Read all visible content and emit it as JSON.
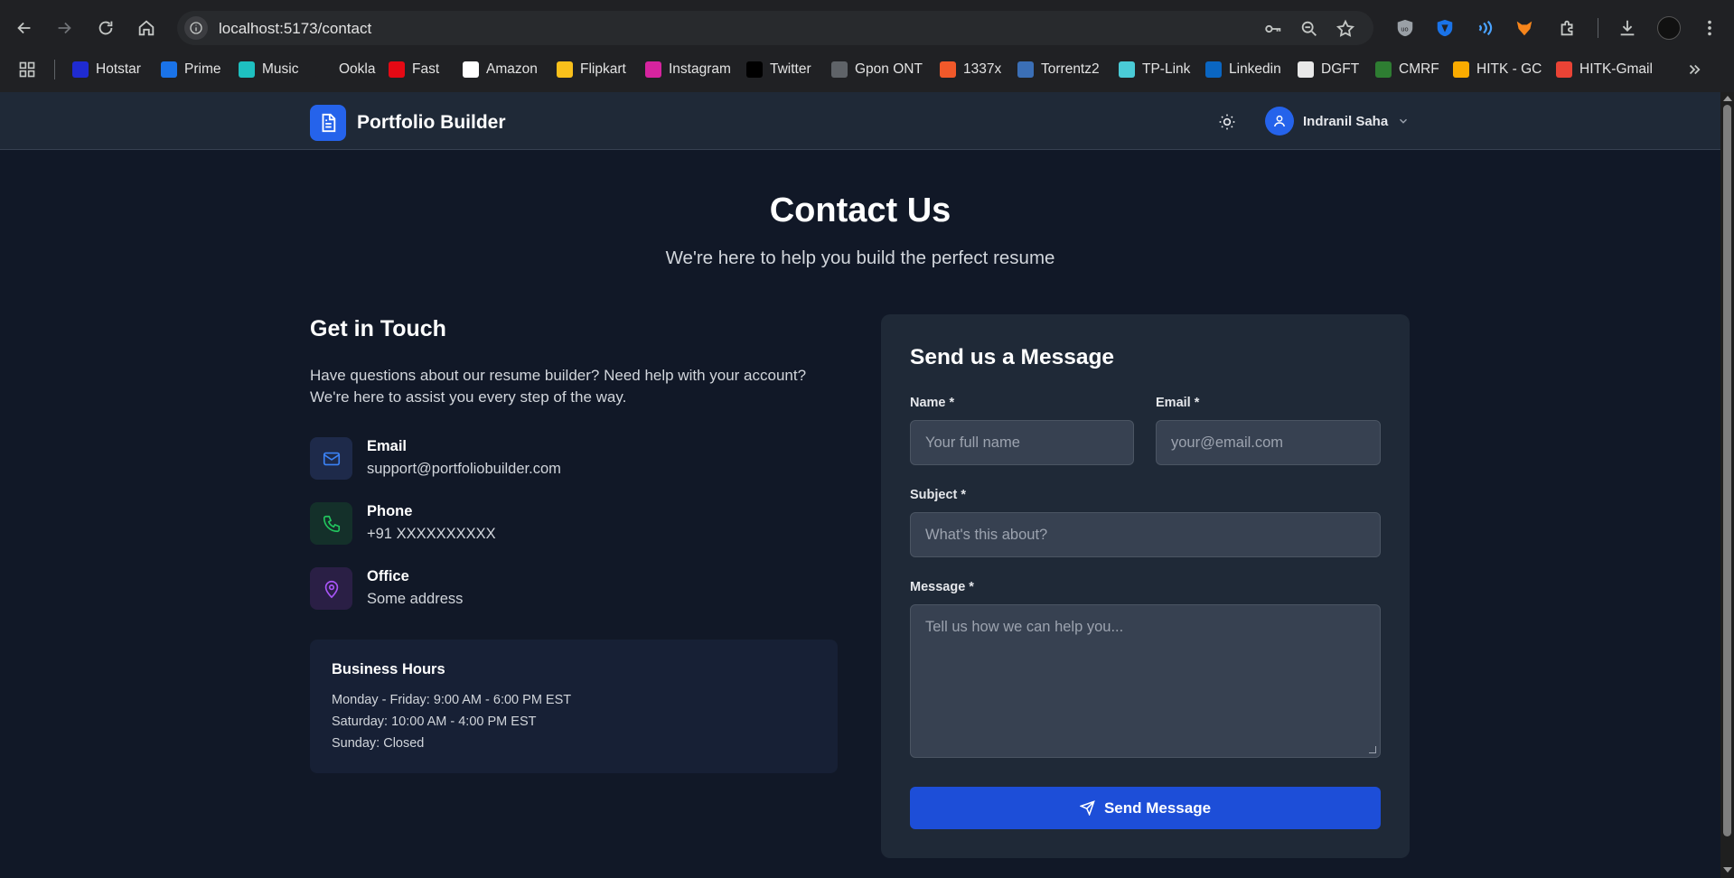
{
  "browser": {
    "url": "localhost:5173/contact",
    "bookmarks": [
      {
        "label": "Hotstar",
        "icon": "hotstar-icon",
        "color": "#1f2bd1"
      },
      {
        "label": "Prime",
        "icon": "prime-icon",
        "color": "#1a73e8"
      },
      {
        "label": "Music",
        "icon": "music-icon",
        "color": "#1ec0c0"
      },
      {
        "label": "Ookla",
        "icon": "ookla-icon",
        "color": "#202124"
      },
      {
        "label": "Fast",
        "icon": "fast-icon",
        "color": "#e50914"
      },
      {
        "label": "Amazon",
        "icon": "amazon-icon",
        "color": "#ffffff"
      },
      {
        "label": "Flipkart",
        "icon": "flipkart-icon",
        "color": "#f9c01b"
      },
      {
        "label": "Instagram",
        "icon": "instagram-icon",
        "color": "#d6249f"
      },
      {
        "label": "Twitter",
        "icon": "x-twitter-icon",
        "color": "#000000"
      },
      {
        "label": "Gpon ONT",
        "icon": "globe-icon",
        "color": "#5f6368"
      },
      {
        "label": "1337x",
        "icon": "1337x-icon",
        "color": "#f1592a"
      },
      {
        "label": "Torrentz2",
        "icon": "torrentz-icon",
        "color": "#3b6fb6"
      },
      {
        "label": "TP-Link",
        "icon": "tplink-icon",
        "color": "#4acbd6"
      },
      {
        "label": "Linkedin",
        "icon": "linkedin-icon",
        "color": "#0a66c2"
      },
      {
        "label": "DGFT",
        "icon": "dgft-icon",
        "color": "#e8e8e8"
      },
      {
        "label": "CMRF",
        "icon": "cmrf-icon",
        "color": "#2e7d32"
      },
      {
        "label": "HITK - GC",
        "icon": "classroom-icon",
        "color": "#f9ab00"
      },
      {
        "label": "HITK-Gmail",
        "icon": "gmail-icon",
        "color": "#ea4335"
      }
    ]
  },
  "header": {
    "brand": "Portfolio Builder",
    "user_name": "Indranil Saha"
  },
  "hero": {
    "title": "Contact Us",
    "subtitle": "We're here to help you build the perfect resume"
  },
  "info": {
    "heading": "Get in Touch",
    "intro": "Have questions about our resume builder? Need help with your account? We're here to assist you every step of the way.",
    "items": [
      {
        "label": "Email",
        "value": "support@portfoliobuilder.com",
        "icon": "mail-icon",
        "color": "#3b82f6",
        "bg": "#1e2a4a"
      },
      {
        "label": "Phone",
        "value": "+91 XXXXXXXXXX",
        "icon": "phone-icon",
        "color": "#22c55e",
        "bg": "#14302a"
      },
      {
        "label": "Office",
        "value": "Some address",
        "icon": "map-pin-icon",
        "color": "#a855f7",
        "bg": "#2a1f45"
      }
    ],
    "hours": {
      "title": "Business Hours",
      "lines": [
        "Monday - Friday: 9:00 AM - 6:00 PM EST",
        "Saturday: 10:00 AM - 4:00 PM EST",
        "Sunday: Closed"
      ]
    }
  },
  "form": {
    "title": "Send us a Message",
    "name_label": "Name *",
    "name_placeholder": "Your full name",
    "email_label": "Email *",
    "email_placeholder": "your@email.com",
    "subject_label": "Subject *",
    "subject_placeholder": "What's this about?",
    "message_label": "Message *",
    "message_placeholder": "Tell us how we can help you...",
    "submit_label": "Send Message"
  }
}
